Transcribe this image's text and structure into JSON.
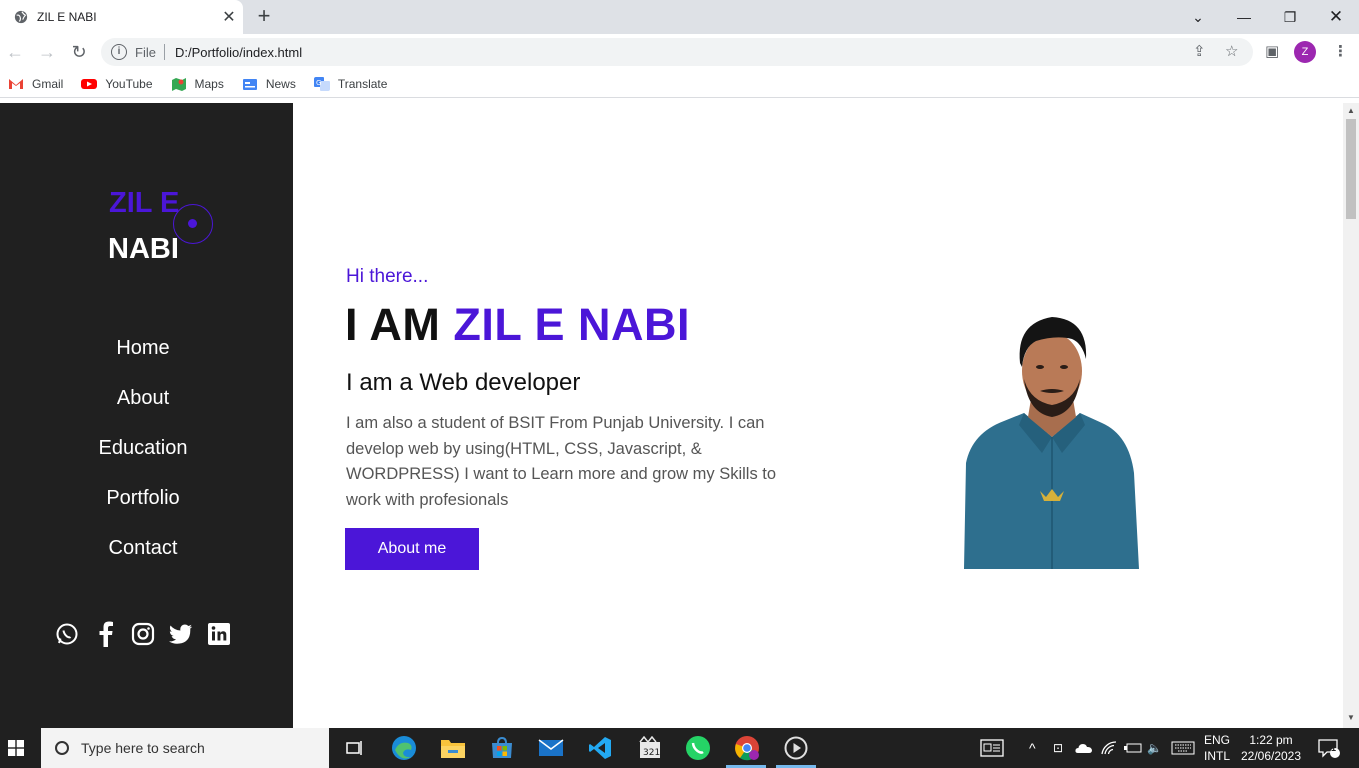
{
  "browser": {
    "tab_title": "ZIL E NABI",
    "scheme_label": "File",
    "address": "D:/Portfolio/index.html",
    "profile_initial": "Z",
    "bookmarks": [
      {
        "label": "Gmail",
        "icon": "gmail-icon",
        "color": "#ea4335"
      },
      {
        "label": "YouTube",
        "icon": "youtube-icon",
        "color": "#ff0000"
      },
      {
        "label": "Maps",
        "icon": "maps-icon",
        "color": "#34a853"
      },
      {
        "label": "News",
        "icon": "news-icon",
        "color": "#4285f4"
      },
      {
        "label": "Translate",
        "icon": "translate-icon",
        "color": "#4285f4"
      }
    ]
  },
  "sidebar": {
    "logo_line1": "ZIL E",
    "logo_line2": "NABI",
    "nav": [
      "Home",
      "About",
      "Education",
      "Portfolio",
      "Contact"
    ],
    "social": [
      "whatsapp-icon",
      "facebook-icon",
      "instagram-icon",
      "twitter-icon",
      "linkedin-icon"
    ]
  },
  "hero": {
    "greeting": "Hi there...",
    "heading_prefix": "I AM",
    "heading_name": "ZIL E NABI",
    "subheading": "I am a Web developer",
    "description": "I am also a student of BSIT From Punjab University. I can develop web by using(HTML, CSS, Javascript, & WORDPRESS) I want to Learn more and grow my Skills to work with profesionals",
    "button_label": "About me"
  },
  "colors": {
    "accent": "#4b16d8",
    "sidebar_bg": "#202020"
  },
  "taskbar": {
    "search_placeholder": "Type here to search",
    "language_line1": "ENG",
    "language_line2": "INTL",
    "time": "1:22 pm",
    "date": "22/06/2023",
    "notification_count": "1"
  }
}
